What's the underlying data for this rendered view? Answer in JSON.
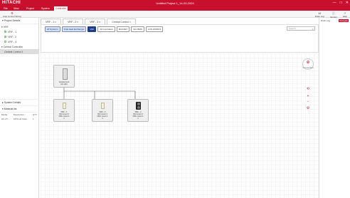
{
  "app": {
    "logo": "HITACHI",
    "title": "Untitled Project 1_14-03-2024"
  },
  "window_controls": [
    "—",
    "□",
    "✕"
  ],
  "menu": [
    {
      "label": "File",
      "active": false
    },
    {
      "label": "View",
      "active": false
    },
    {
      "label": "Project",
      "active": false
    },
    {
      "label": "System",
      "active": false
    },
    {
      "label": "Controller",
      "active": true
    }
  ],
  "ribbon": {
    "auto_wiring": "Auto Control Wiring",
    "right": [
      {
        "label": "Drain Log"
      },
      {
        "label": "Version"
      },
      {
        "label": "Help"
      }
    ]
  },
  "project_details": {
    "header": "Project Details",
    "vrf_group": "VRF",
    "vrf_items": [
      "VRF - 1",
      "VRF - 2",
      "VRF - 3"
    ],
    "cc_group": "Central Controller",
    "cc_items": [
      "Central Control 1"
    ]
  },
  "system_details": {
    "header": "System Details"
  },
  "material_list": {
    "header": "Material list",
    "columns": [
      "Model",
      "Description",
      "QTY"
    ],
    "rows": [
      [
        "HC-A7...",
        "AirCloud Gate...",
        "1"
      ]
    ]
  },
  "tabs": [
    {
      "label": "VRF - 1",
      "close": "×"
    },
    {
      "label": "VRF - 2",
      "close": "×"
    },
    {
      "label": "VRF - 3",
      "close": "×"
    },
    {
      "label": "Central Control",
      "close": "×"
    }
  ],
  "filters": [
    {
      "label": "All Systems",
      "style": "blue"
    },
    {
      "label": "Total Heat Exchanger",
      "style": "blue"
    },
    {
      "label": "VRF",
      "style": "dark"
    },
    {
      "label": "All Controllers",
      "style": "plain"
    },
    {
      "label": "BACNET",
      "style": "plain"
    },
    {
      "label": "Std. BMS",
      "style": "plain"
    },
    {
      "label": "LON WORKS",
      "style": "plain"
    }
  ],
  "search": {
    "placeholder": "Search",
    "icon": "search-icon"
  },
  "right_panel": {
    "tab1": "Drain Log",
    "tab2": "Navigate"
  },
  "devices": {
    "central": {
      "lines": [
        "Central Cont",
        "HC-A64"
      ]
    },
    "units": [
      {
        "lines": [
          "VRF - 1",
          "IDU count 3",
          "ODU count 1"
        ],
        "qty": "1"
      },
      {
        "lines": [
          "VRF - 2",
          "IDU count 3",
          "ODU count 1"
        ],
        "qty": "1"
      },
      {
        "lines": [
          "VRF - 3",
          "IDU count 3",
          "ODU count 1"
        ],
        "qty": "1"
      }
    ]
  },
  "connection": {
    "label": "Connection",
    "icon": "plus-circle-icon"
  },
  "zoom_controls": [
    {
      "icon": "reset-icon",
      "glyph": "⟲"
    },
    {
      "icon": "zoom-in-icon",
      "glyph": "+"
    },
    {
      "icon": "zoom-out-icon",
      "glyph": "−"
    },
    {
      "icon": "settings-icon",
      "glyph": "⚙"
    }
  ],
  "colors": {
    "brand": "#c8102e",
    "chip_blue": "#cfe2ff",
    "chip_dark": "#1f3c88"
  }
}
